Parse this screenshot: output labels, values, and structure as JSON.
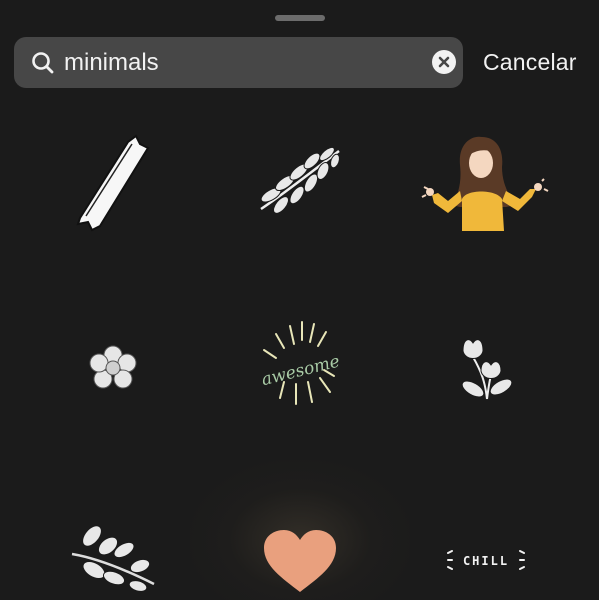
{
  "search": {
    "query": "minimals",
    "cancel_label": "Cancelar"
  },
  "icons": {
    "search": "search-icon",
    "clear": "clear-icon"
  },
  "stickers": [
    {
      "name": "sticker-tape",
      "description_icon": "tape-icon"
    },
    {
      "name": "sticker-fern-leaf",
      "description_icon": "leaf-icon"
    },
    {
      "name": "sticker-shrugging-girl",
      "description_icon": "shrug-icon"
    },
    {
      "name": "sticker-small-flower",
      "description_icon": "flower-icon"
    },
    {
      "name": "sticker-awesome",
      "text": "awesome"
    },
    {
      "name": "sticker-tulip-flowers",
      "description_icon": "tulip-icon"
    },
    {
      "name": "sticker-branch",
      "description_icon": "branch-icon"
    },
    {
      "name": "sticker-heart",
      "description_icon": "heart-icon"
    },
    {
      "name": "sticker-chill",
      "text": "CHILL"
    }
  ],
  "colors": {
    "background": "#1b1b1b",
    "search_bar": "#474747",
    "text": "#f2f2f2",
    "heart": "#e9a07e",
    "shirt": "#f0b83a",
    "awesome_text": "#a9cba6"
  }
}
